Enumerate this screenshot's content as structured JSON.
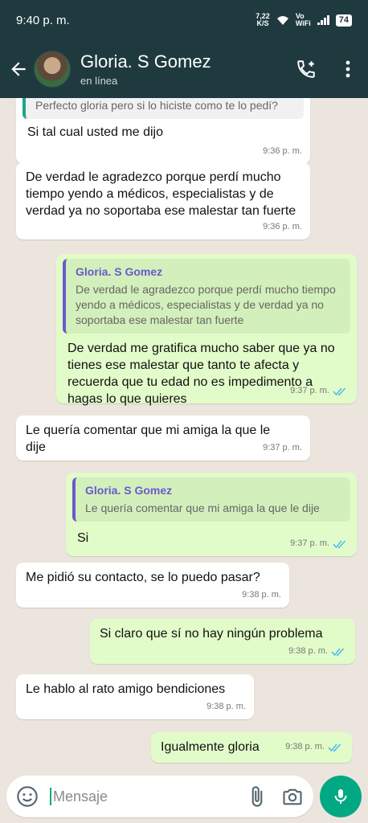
{
  "status_bar": {
    "time": "9:40 p. m.",
    "net_speed_top": "7,22",
    "net_speed_bottom": "K/S",
    "wifi_top": "Vo",
    "wifi_bottom": "WiFi",
    "battery": "74"
  },
  "header": {
    "contact_name": "Gloria. S Gomez",
    "contact_status": "en línea",
    "icons": [
      "back-arrow-icon",
      "avatar",
      "add-call-icon",
      "more-vert-icon"
    ]
  },
  "messages": [
    {
      "id": "m1",
      "dir": "in",
      "quote": {
        "text": "Perfecto gloria pero si lo hiciste como te lo pedí?"
      },
      "text": "Si tal cual usted me dijo",
      "time": "9:36 p. m."
    },
    {
      "id": "m2",
      "dir": "in",
      "text": "De verdad le agradezco porque perdí mucho tiempo yendo a médicos, especialistas y de verdad ya no soportaba ese malestar tan fuerte",
      "time": "9:36 p. m."
    },
    {
      "id": "m3",
      "dir": "out",
      "quote": {
        "name": "Gloria. S Gomez",
        "text": "De verdad le agradezco porque perdí mucho tiempo yendo a médicos, especialistas y de verdad ya no soportaba ese malestar tan fuerte"
      },
      "text": "De verdad me gratifica mucho saber que ya no tienes ese malestar que tanto te afecta y recuerda que tu edad no es impedimento a hagas lo que quieres",
      "time": "9:37 p. m.",
      "read": true
    },
    {
      "id": "m4",
      "dir": "in",
      "text": "Le quería comentar que mi amiga la que le dije",
      "time": "9:37 p. m."
    },
    {
      "id": "m5",
      "dir": "out",
      "quote": {
        "name": "Gloria. S Gomez",
        "text": "Le quería comentar que mi amiga la que le dije"
      },
      "text": "Si",
      "time": "9:37 p. m.",
      "read": true
    },
    {
      "id": "m6",
      "dir": "in",
      "text": "Me pidió su contacto, se lo puedo pasar?",
      "time": "9:38 p. m."
    },
    {
      "id": "m7",
      "dir": "out",
      "text": "Si claro que sí no hay ningún problema",
      "time": "9:38 p. m.",
      "read": true
    },
    {
      "id": "m8",
      "dir": "in",
      "text": "Le hablo al rato amigo bendiciones",
      "time": "9:38 p. m."
    },
    {
      "id": "m9",
      "dir": "out",
      "text": "Igualmente gloria",
      "time": "9:38 p. m.",
      "read": true
    }
  ],
  "composer": {
    "placeholder": "Mensaje",
    "icons": [
      "emoji-icon",
      "attach-icon",
      "camera-icon",
      "mic-icon"
    ]
  },
  "colors": {
    "header": "#1f3a3f",
    "incoming": "#ffffff",
    "outgoing": "#e2fcc9",
    "accent": "#00a884",
    "read_ticks": "#53bdeb",
    "quote_name": "#6a5acd"
  }
}
